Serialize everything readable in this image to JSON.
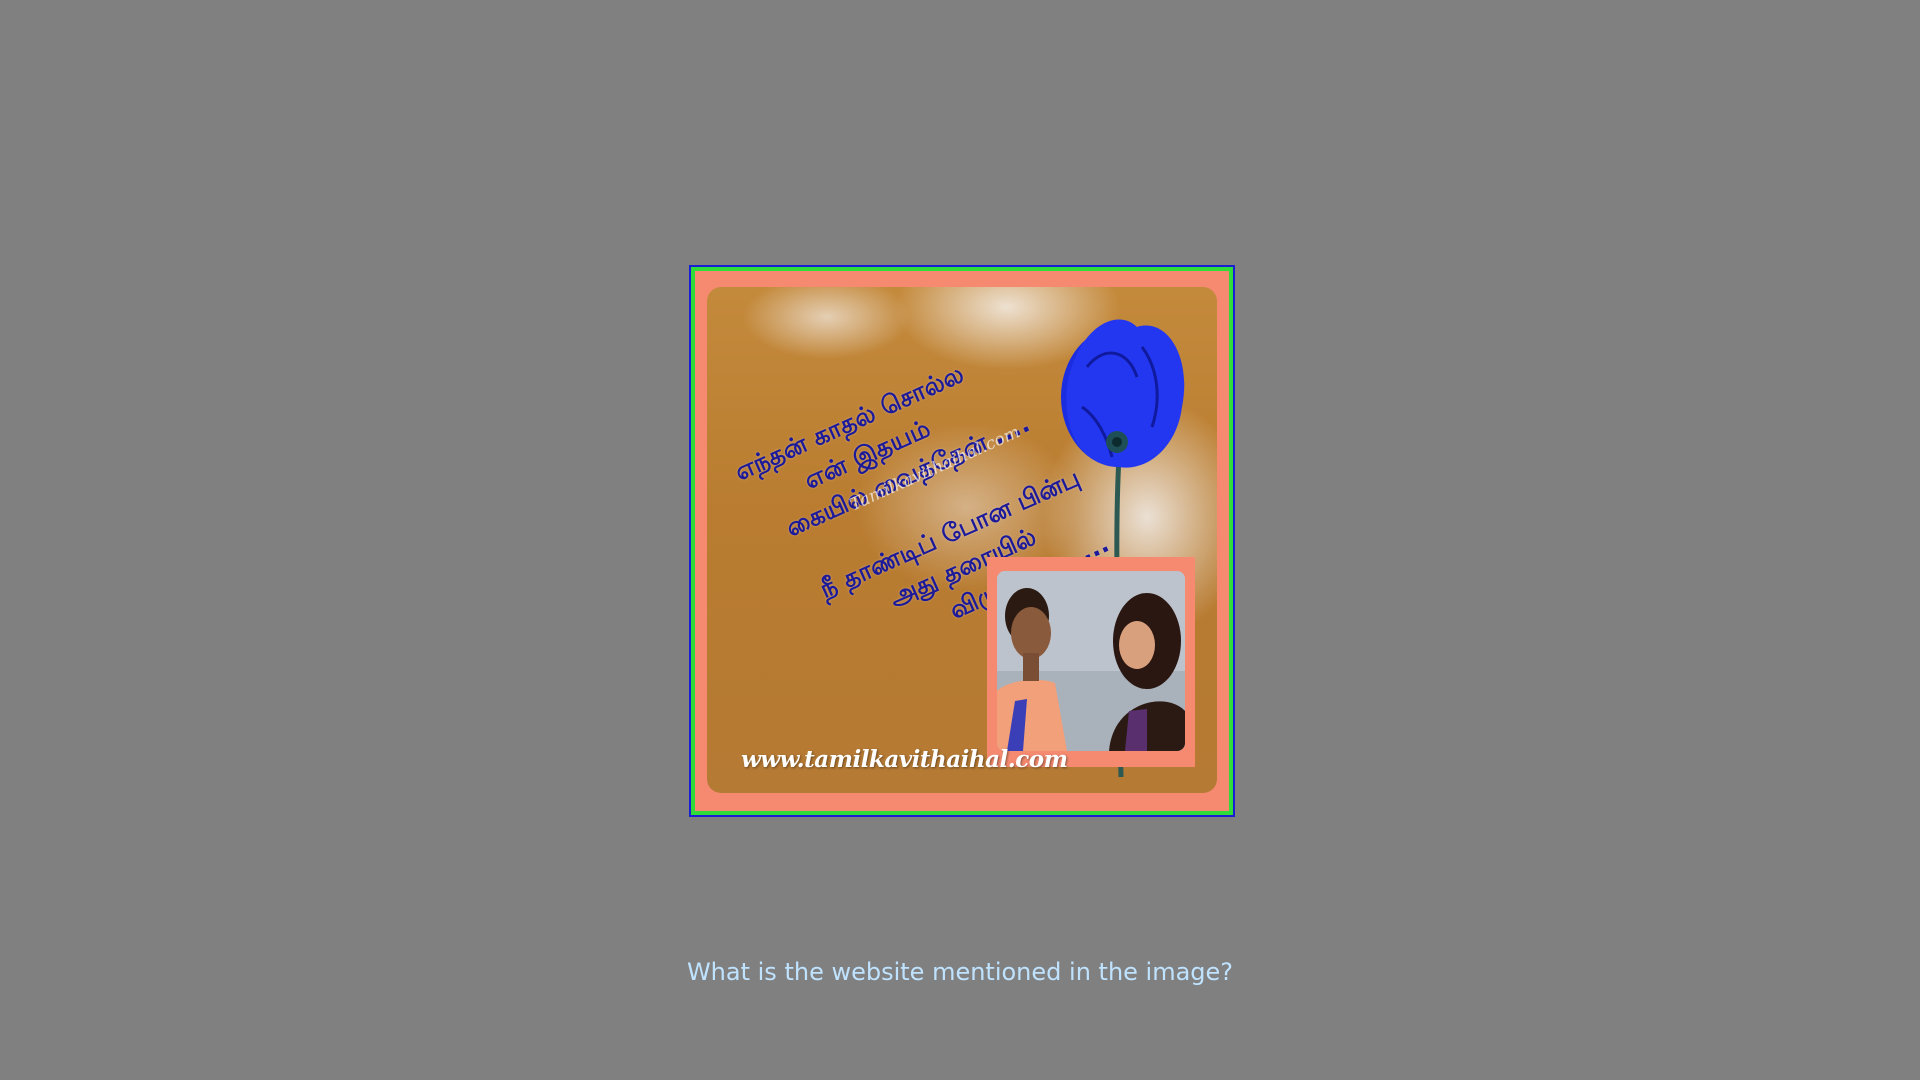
{
  "image": {
    "poem_lines": [
      "எந்தன் காதல் சொல்ல",
      "என் இதயம்",
      "கையில் வைத்தேன் ....",
      "நீ தாண்டிப் போன பின்பு",
      "அது தரையில்",
      "விழுந்ததடி....."
    ],
    "watermark": "Tamilkavithaihal.com",
    "website_url": "www.tamilkavithaihal.com"
  },
  "question": "What is the website mentioned in the image?"
}
